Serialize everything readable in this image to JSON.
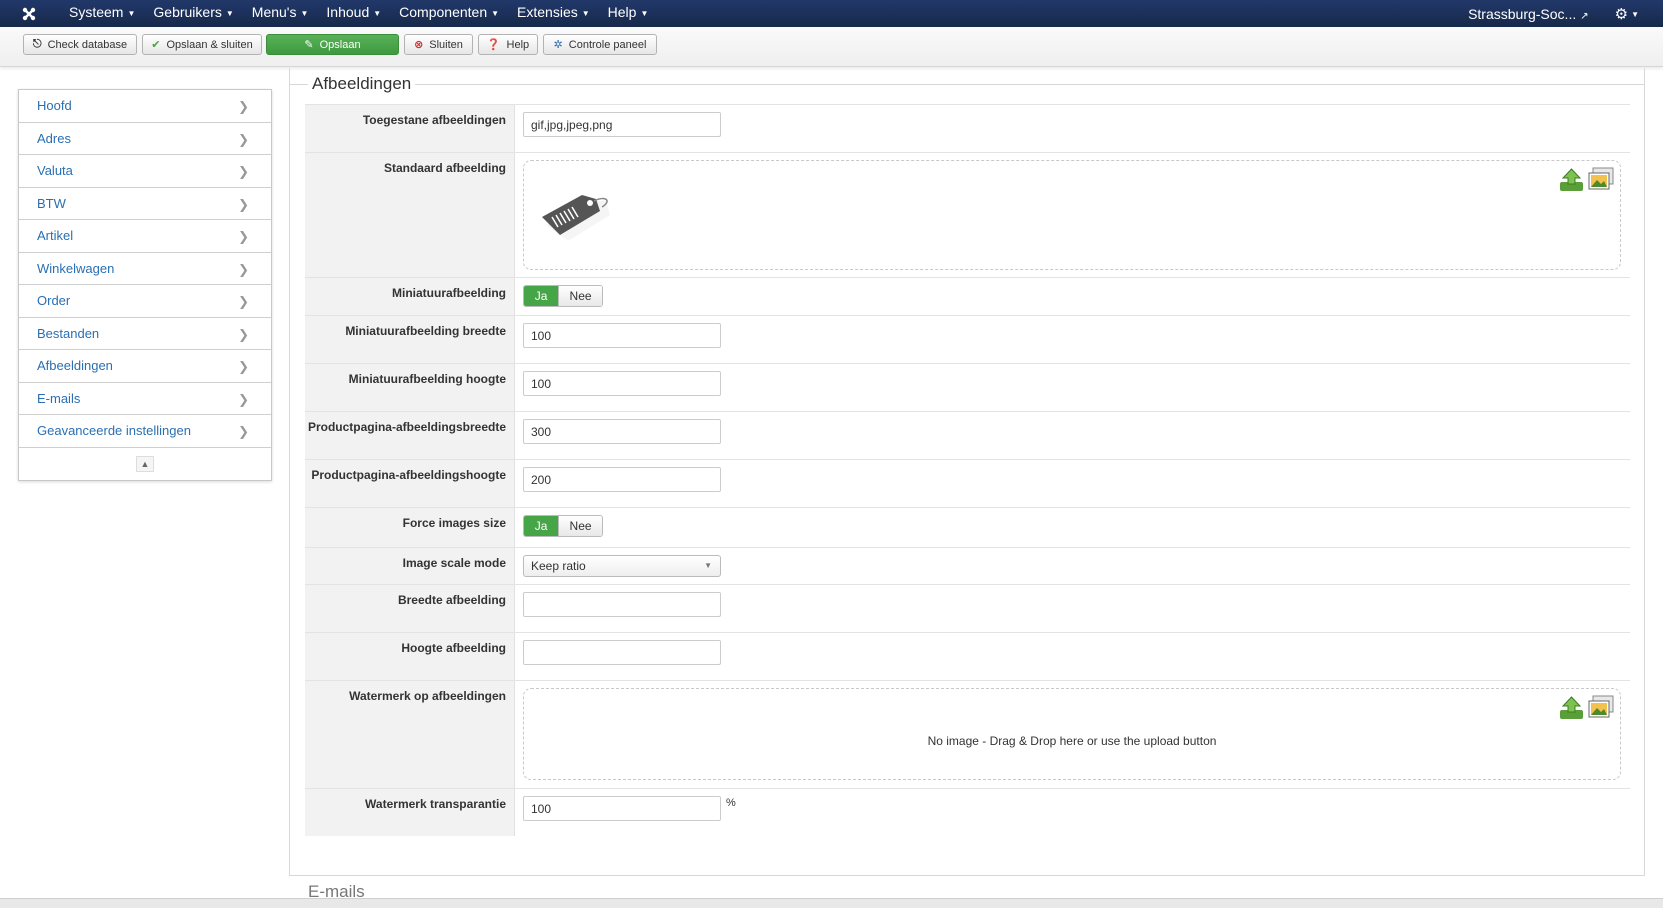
{
  "navbar": {
    "menu": [
      "Systeem",
      "Gebruikers",
      "Menu's",
      "Inhoud",
      "Componenten",
      "Extensies",
      "Help"
    ],
    "site_name": "Strassburg-Soc..."
  },
  "toolbar": {
    "check_database": "Check database",
    "save_close": "Opslaan & sluiten",
    "save": "Opslaan",
    "close": "Sluiten",
    "help": "Help",
    "control_panel": "Controle paneel"
  },
  "sidebar": {
    "items": [
      "Hoofd",
      "Adres",
      "Valuta",
      "BTW",
      "Artikel",
      "Winkelwagen",
      "Order",
      "Bestanden",
      "Afbeeldingen",
      "E-mails",
      "Geavanceerde instellingen"
    ]
  },
  "section": {
    "title": "Afbeeldingen",
    "next_title": "E-mails"
  },
  "fields": {
    "allowed_images": {
      "label": "Toegestane afbeeldingen",
      "value": "gif,jpg,jpeg,png"
    },
    "default_image": {
      "label": "Standaard afbeelding"
    },
    "thumbnail": {
      "label": "Miniatuurafbeelding",
      "yes": "Ja",
      "no": "Nee"
    },
    "thumb_width": {
      "label": "Miniatuurafbeelding breedte",
      "value": "100"
    },
    "thumb_height": {
      "label": "Miniatuurafbeelding hoogte",
      "value": "100"
    },
    "product_width": {
      "label": "Productpagina-afbeeldingsbreedte",
      "value": "300"
    },
    "product_height": {
      "label": "Productpagina-afbeeldingshoogte",
      "value": "200"
    },
    "force_size": {
      "label": "Force images size",
      "yes": "Ja",
      "no": "Nee"
    },
    "scale_mode": {
      "label": "Image scale mode",
      "value": "Keep ratio"
    },
    "image_width": {
      "label": "Breedte afbeelding",
      "value": ""
    },
    "image_height": {
      "label": "Hoogte afbeelding",
      "value": ""
    },
    "watermark": {
      "label": "Watermerk op afbeeldingen",
      "empty_text": "No image - Drag & Drop here or use the upload button"
    },
    "watermark_opacity": {
      "label": "Watermerk transparantie",
      "value": "100",
      "unit": "%"
    }
  },
  "colors": {
    "navbar": "#1b3258",
    "link": "#2a6fb3",
    "success": "#46a546"
  }
}
